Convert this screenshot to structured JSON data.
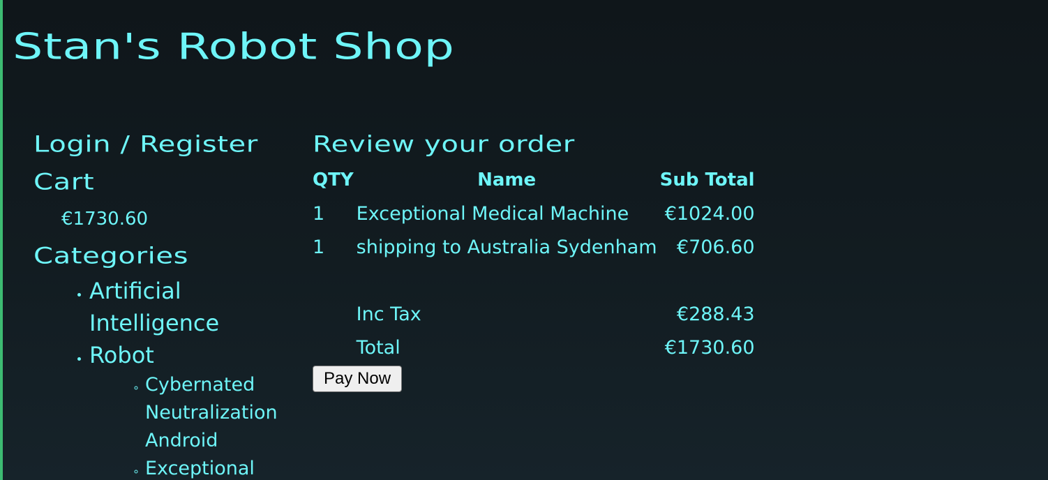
{
  "site": {
    "title": "Stan's Robot Shop"
  },
  "sidebar": {
    "login_label": "Login / Register",
    "cart_label": "Cart",
    "cart_total": "€1730.60",
    "categories_label": "Categories",
    "categories": [
      {
        "label_line1": "Artificial",
        "label_line2": "Intelligence"
      },
      {
        "label": "Robot",
        "children": [
          {
            "line1": "Cybernated",
            "line2": "Neutralization",
            "line3": "Android"
          },
          {
            "line1": "Exceptional"
          }
        ]
      }
    ]
  },
  "order": {
    "heading": "Review your order",
    "columns": {
      "qty": "QTY",
      "name": "Name",
      "subtotal": "Sub Total"
    },
    "items": [
      {
        "qty": "1",
        "name": "Exceptional Medical Machine",
        "subtotal": "€1024.00"
      },
      {
        "qty": "1",
        "name": "shipping to Australia Sydenham",
        "subtotal": "€706.60"
      }
    ],
    "tax_label": "Inc Tax",
    "tax_value": "€288.43",
    "total_label": "Total",
    "total_value": "€1730.60",
    "pay_button": "Pay Now"
  },
  "colors": {
    "accent": "#6ef5f8",
    "background": "#0f161a",
    "left_border": "#3dbb72"
  }
}
